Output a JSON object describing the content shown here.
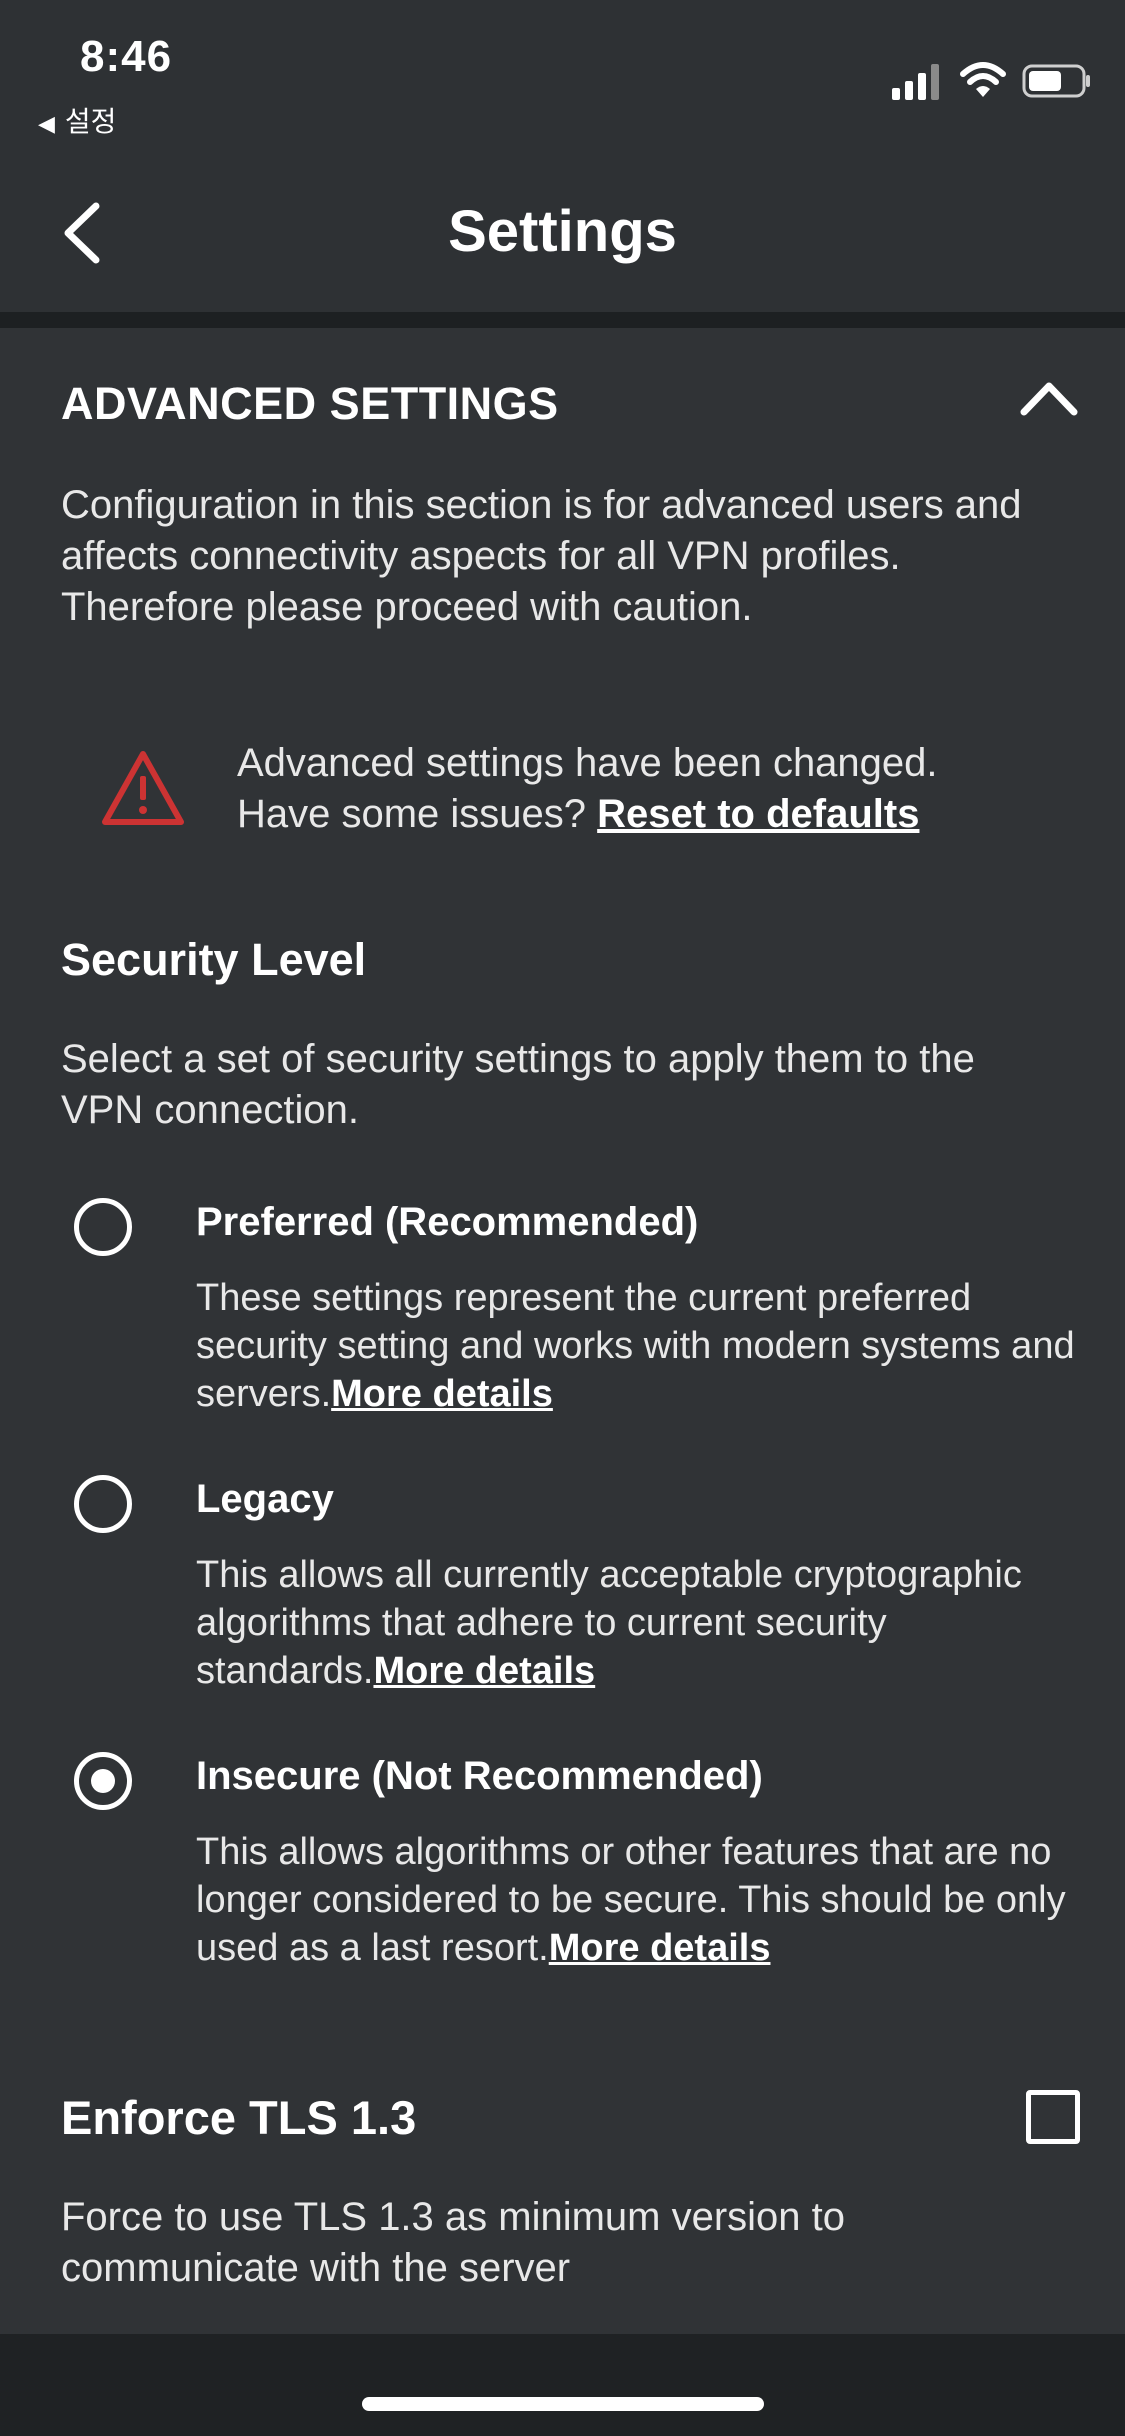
{
  "status_bar": {
    "time": "8:46",
    "back_app": "설정",
    "back_arrow_icon": "back-triangle-icon",
    "icons": [
      "signal-icon",
      "wifi-icon",
      "battery-icon"
    ]
  },
  "nav": {
    "title": "Settings",
    "back_icon": "chevron-left-icon"
  },
  "advanced": {
    "heading": "ADVANCED SETTINGS",
    "collapse_icon": "chevron-up-icon",
    "description": "Configuration in this section is for advanced users and affects connectivity aspects for all VPN profiles. Therefore please proceed with caution.",
    "warning": {
      "icon": "warning-triangle-icon",
      "icon_color": "#cc3333",
      "line1": "Advanced settings have been changed.",
      "line2_prefix": "Have some issues? ",
      "reset_link": "Reset to defaults"
    }
  },
  "security_level": {
    "heading": "Security Level",
    "description": "Select a set of security settings to apply them to the VPN connection.",
    "more_details": "More details",
    "options": [
      {
        "title": "Preferred (Recommended)",
        "description": "These settings represent the current preferred security setting and works with modern systems and servers.",
        "selected": false
      },
      {
        "title": "Legacy",
        "description": "This allows all currently acceptable cryptographic algorithms that adhere to current security standards.",
        "selected": false
      },
      {
        "title": "Insecure (Not Recommended)",
        "description": "This allows algorithms or other features that are no longer considered to be secure. This should be only used as a last resort.",
        "selected": true
      }
    ]
  },
  "tls": {
    "heading": "Enforce TLS 1.3",
    "description": "Force to use TLS 1.3 as minimum version  to communicate with the server",
    "checked": false
  },
  "colors": {
    "background": "#303336",
    "header": "#2e3134",
    "text": "#ffffff",
    "warning": "#cc3333"
  }
}
